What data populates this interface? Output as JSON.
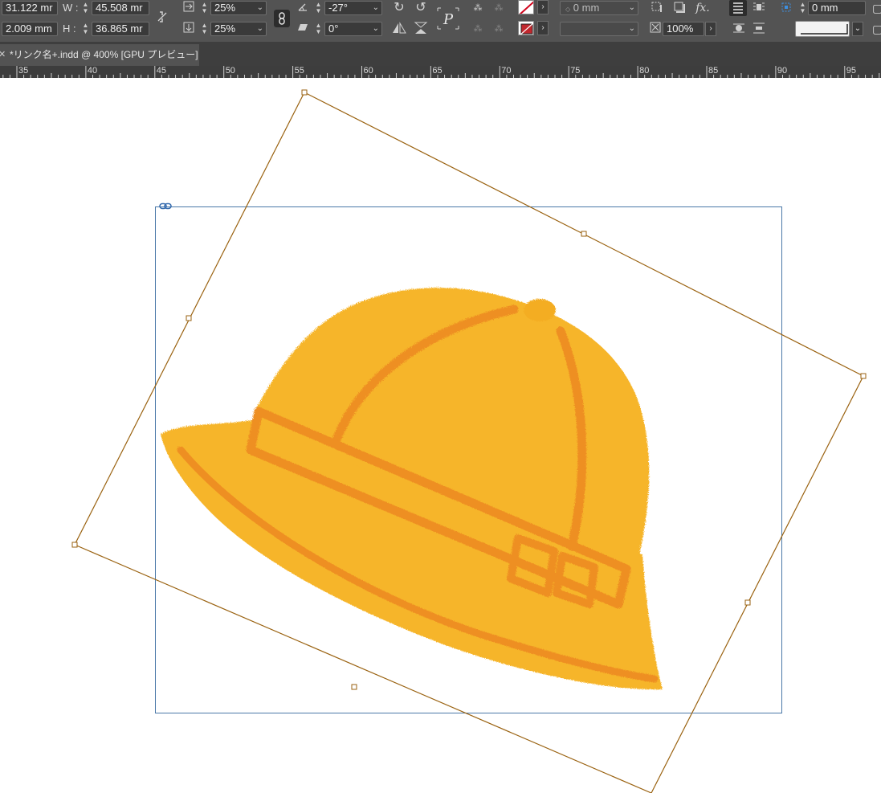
{
  "control_bar": {
    "x_value": "31.122 mr",
    "y_value": "2.009 mm",
    "w_label": "W :",
    "w_value": "45.508 mr",
    "h_label": "H :",
    "h_value": "36.865 mr",
    "scale_x": "25%",
    "scale_y": "25%",
    "rotation": "-27°",
    "shear": "0°",
    "stroke_weight": "0 mm",
    "stroke_style": "",
    "opacity": "100%",
    "offset": "0 mm",
    "colors": {
      "bar_bg": "#535353",
      "field_bg": "#3a3a3a",
      "stroke_none_red": "#d0021b",
      "fill_red": "#c1272d"
    }
  },
  "tabs": [
    {
      "label": "*リンク名+.indd @ 400% [GPU プレビュー]",
      "close_icon": "close-icon"
    }
  ],
  "ruler": {
    "labels": [
      "35",
      "40",
      "45",
      "50",
      "55",
      "60",
      "65",
      "70",
      "75",
      "80",
      "85",
      "90",
      "95"
    ]
  },
  "canvas": {
    "hat_color": "#f6b52a",
    "hat_band_color": "#ee8f22",
    "frame_color": "#9a6210",
    "container_color": "#4a78a8"
  }
}
